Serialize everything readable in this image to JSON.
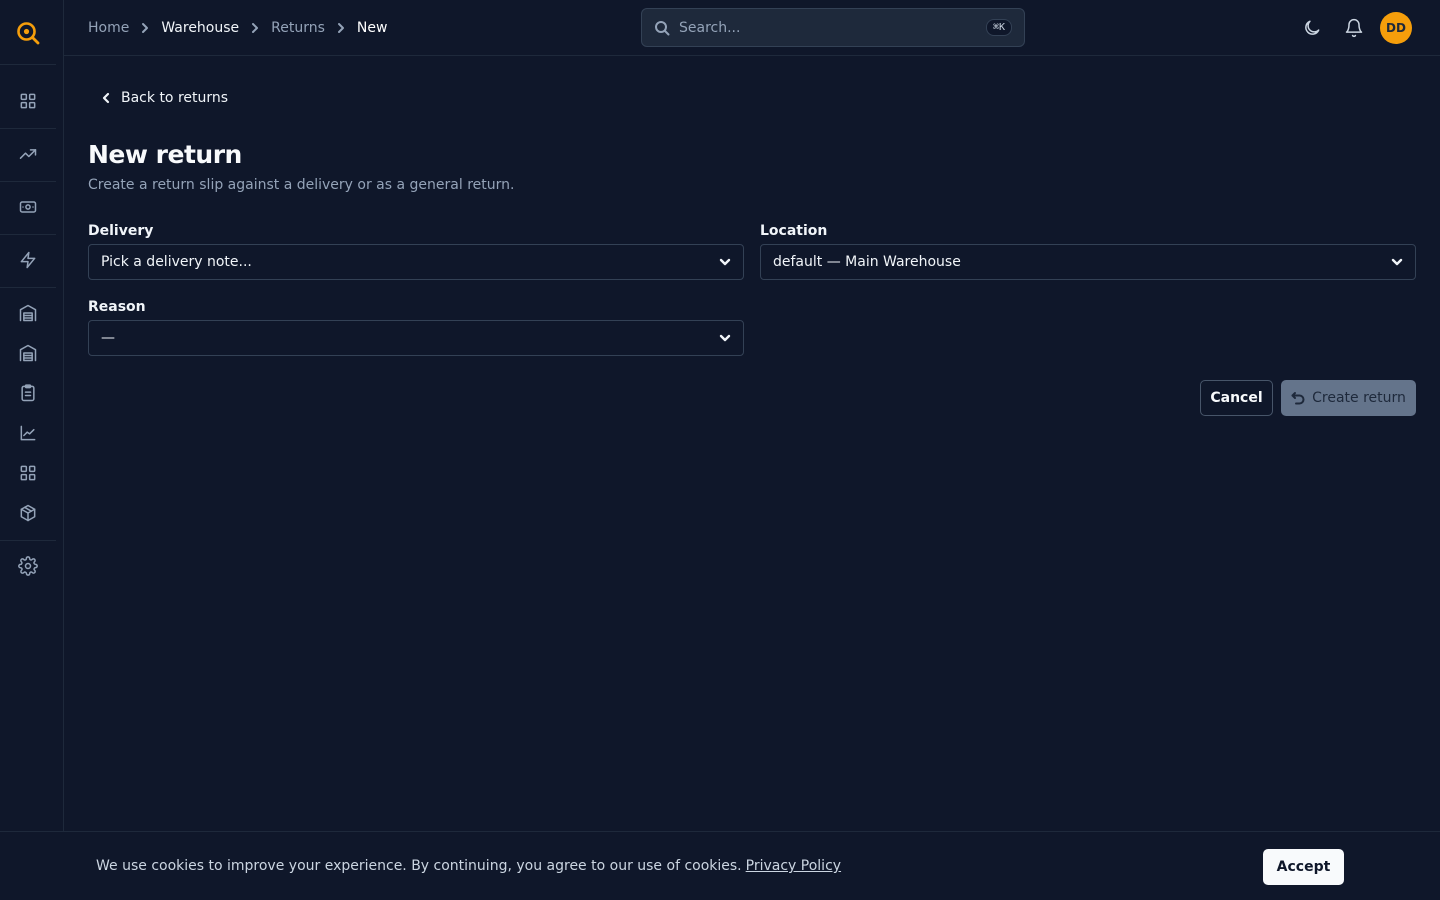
{
  "colors": {
    "background": "#0f172a",
    "border": "#1e293b",
    "brand": "#f59e0b",
    "muted_text": "#94a3b8",
    "disabled_button": "#64748b"
  },
  "sidebar": {
    "logo_icon": "search-logo-icon",
    "items": [
      {
        "icon": "dashboard-icon"
      },
      {
        "icon": "trending-up-icon"
      },
      {
        "icon": "banknote-icon"
      },
      {
        "icon": "lightning-icon"
      },
      {
        "icon": "warehouse-icon"
      },
      {
        "icon": "warehouse-alt-icon"
      },
      {
        "icon": "clipboard-list-icon"
      },
      {
        "icon": "line-chart-icon"
      },
      {
        "icon": "grid-icon"
      },
      {
        "icon": "package-icon"
      },
      {
        "icon": "gear-icon"
      }
    ]
  },
  "header": {
    "breadcrumb": [
      "Home",
      "Warehouse",
      "Returns",
      "New"
    ],
    "search": {
      "placeholder": "Search...",
      "shortcut": "⌘K"
    },
    "avatar_initials": "DD"
  },
  "main": {
    "back_label": "Back to returns",
    "title": "New return",
    "subtitle": "Create a return slip against a delivery or as a general return.",
    "fields": {
      "delivery": {
        "label": "Delivery",
        "value": "Pick a delivery note..."
      },
      "location": {
        "label": "Location",
        "value": "default — Main Warehouse"
      },
      "reason": {
        "label": "Reason",
        "value": "—"
      }
    },
    "actions": {
      "cancel": "Cancel",
      "create": "Create return"
    }
  },
  "cookie": {
    "text": "We use cookies to improve your experience. By continuing, you agree to our use of cookies.",
    "link": "Privacy Policy",
    "accept": "Accept"
  }
}
